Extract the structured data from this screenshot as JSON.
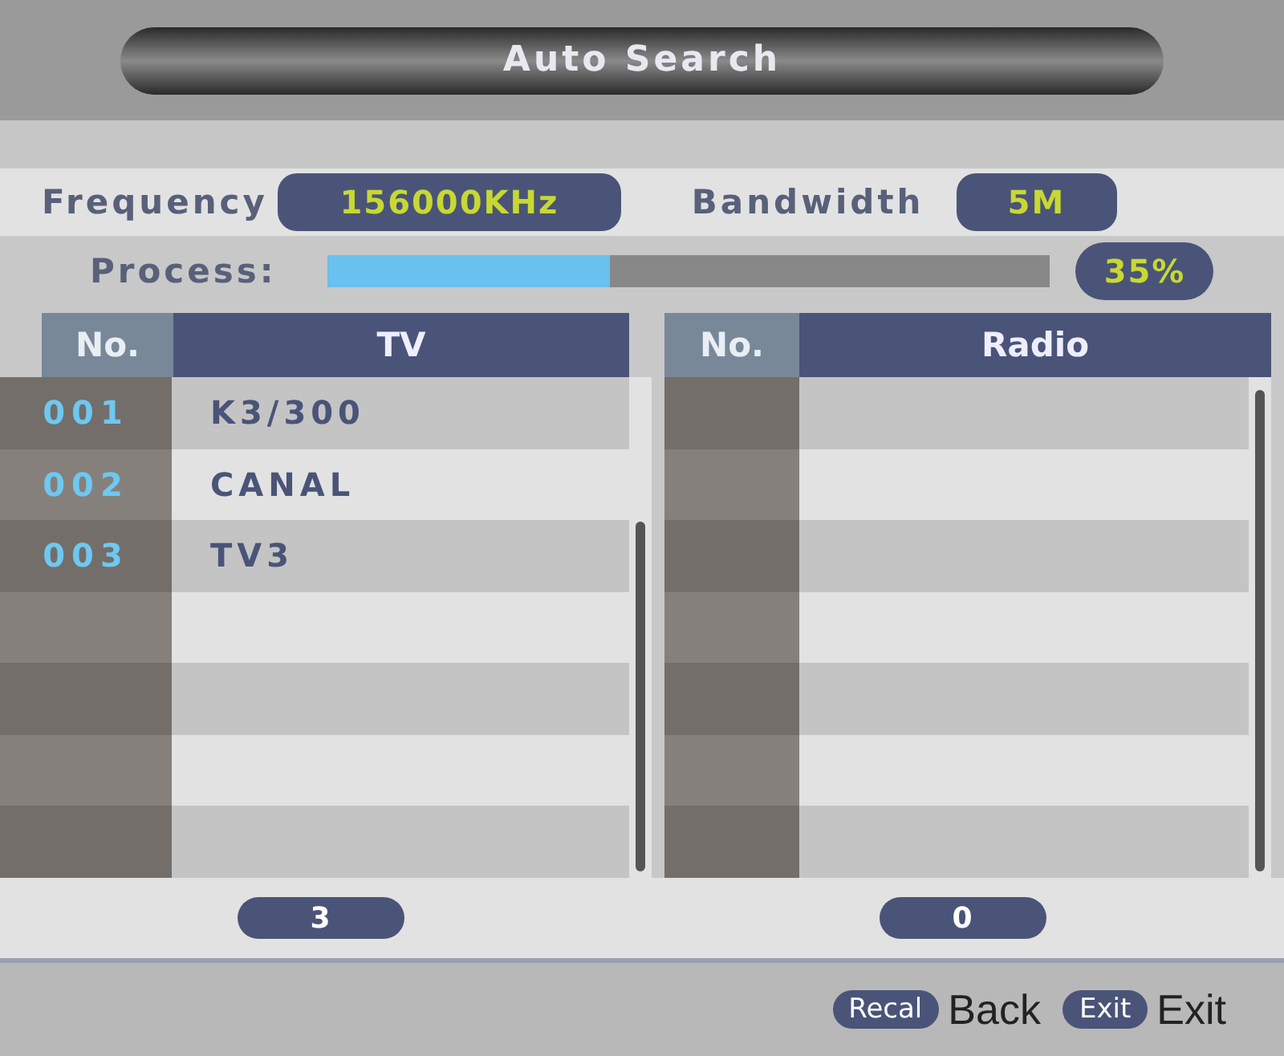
{
  "title": "Auto Search",
  "frequency": {
    "label": "Frequency",
    "value": "156000KHz"
  },
  "bandwidth": {
    "label": "Bandwidth",
    "value": "5M"
  },
  "process": {
    "label": "Process:",
    "level": 0.39,
    "reading": "35%"
  },
  "tv": {
    "columns": [
      "No.",
      "TV"
    ],
    "rows": [
      {
        "no": "001",
        "name": "K3/300"
      },
      {
        "no": "002",
        "name": "CANAL"
      },
      {
        "no": "003",
        "name": "TV3"
      }
    ],
    "count": "3"
  },
  "radio": {
    "columns": [
      "No.",
      "Radio"
    ],
    "count": "0"
  },
  "footer": [
    {
      "key": "Recal",
      "label": "Back"
    },
    {
      "key": "Exit",
      "label": "Exit"
    }
  ]
}
